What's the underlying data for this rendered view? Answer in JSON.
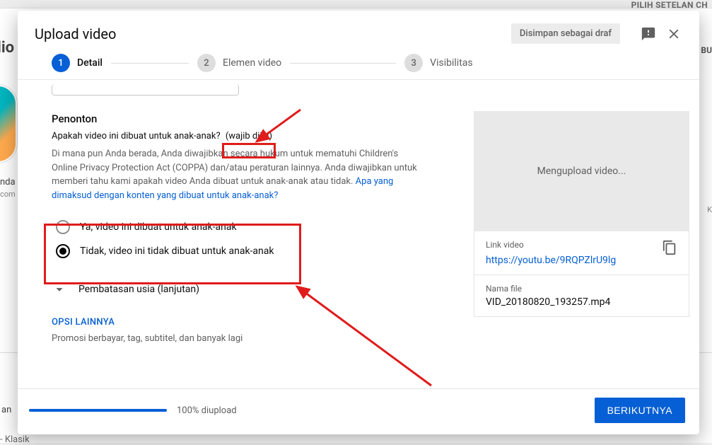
{
  "bg": {
    "pilih": "PILIH SETELAN CH",
    "bu": "BU",
    "k": "K",
    "studio": "lio",
    "nda": "nda",
    "com": "com",
    "an": "an",
    "klasik": "- Klasik"
  },
  "header": {
    "title": "Upload video",
    "draft_status": "Disimpan sebagai draf"
  },
  "stepper": {
    "steps": [
      {
        "num": "1",
        "label": "Detail"
      },
      {
        "num": "2",
        "label": "Elemen video"
      },
      {
        "num": "3",
        "label": "Visibilitas"
      }
    ]
  },
  "audience": {
    "heading": "Penonton",
    "question_prefix": "Apakah video ini dibuat untuk anak-anak? ",
    "question_required": "(wajib diisi)",
    "description_pre": "Di mana pun Anda berada, Anda diwajibkan secara hukum untuk mematuhi Children's Online Privacy Protection Act (COPPA) dan/atau peraturan lainnya. Anda diwajibkan untuk memberi tahu kami apakah video Anda dibuat untuk anak-anak atau tidak. ",
    "description_link": "Apa yang dimaksud dengan konten yang dibuat untuk anak-anak?",
    "radio_yes": "Ya, video ini dibuat untuk anak-anak",
    "radio_no": "Tidak, video ini tidak dibuat untuk anak-anak",
    "age_restriction": "Pembatasan usia (lanjutan)"
  },
  "more": {
    "link": "OPSI LAINNYA",
    "sub": "Promosi berbayar, tag, subtitel, dan banyak lagi"
  },
  "preview": {
    "uploading": "Mengupload video...",
    "link_label": "Link video",
    "link_url": "https://youtu.be/9RQPZlrU9lg",
    "file_label": "Nama file",
    "file_name": "VID_20180820_193257.mp4"
  },
  "footer": {
    "progress_text": "100% diupload",
    "next": "BERIKUTNYA"
  }
}
